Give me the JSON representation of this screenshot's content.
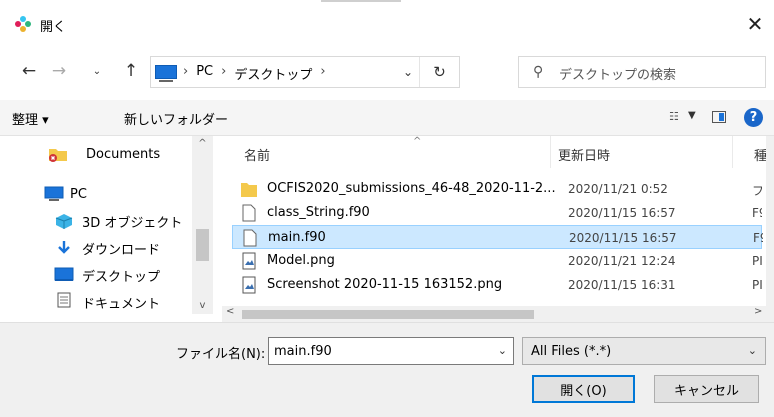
{
  "window": {
    "title": "開く"
  },
  "address": {
    "crumbs": [
      "PC",
      "デスクトップ"
    ]
  },
  "search": {
    "placeholder": "デスクトップの検索"
  },
  "toolbar": {
    "organize": "整理 ▾",
    "new_folder": "新しいフォルダー",
    "help": "?"
  },
  "nav": {
    "items": [
      {
        "label": "Documents",
        "icon": "documents-folder-icon"
      },
      {
        "label": "PC",
        "icon": "pc-icon"
      },
      {
        "label": "3D オブジェクト",
        "icon": "3d-objects-icon"
      },
      {
        "label": "ダウンロード",
        "icon": "download-icon"
      },
      {
        "label": "デスクトップ",
        "icon": "desktop-icon"
      },
      {
        "label": "ドキュメント",
        "icon": "document-icon"
      }
    ]
  },
  "columns": {
    "name": "名前",
    "date": "更新日時",
    "type": "種"
  },
  "files": [
    {
      "name": "OCFIS2020_submissions_46-48_2020-11-2...",
      "date": "2020/11/21 0:52",
      "type": "フ",
      "icon": "folder-icon"
    },
    {
      "name": "class_String.f90",
      "date": "2020/11/15 16:57",
      "type": "F9",
      "icon": "file-icon"
    },
    {
      "name": "main.f90",
      "date": "2020/11/15 16:57",
      "type": "F9",
      "icon": "file-icon",
      "selected": true
    },
    {
      "name": "Model.png",
      "date": "2020/11/21 12:24",
      "type": "PI",
      "icon": "image-file-icon"
    },
    {
      "name": "Screenshot 2020-11-15 163152.png",
      "date": "2020/11/15 16:31",
      "type": "PI",
      "icon": "image-file-icon"
    }
  ],
  "bottom": {
    "filename_label": "ファイル名(N):",
    "filename_value": "main.f90",
    "filter_value": "All Files (*.*)",
    "open_label": "開く(O)",
    "cancel_label": "キャンセル"
  },
  "colors": {
    "accent": "#0078d7",
    "selection": "#cce8ff",
    "folder": "#f4c94c"
  }
}
